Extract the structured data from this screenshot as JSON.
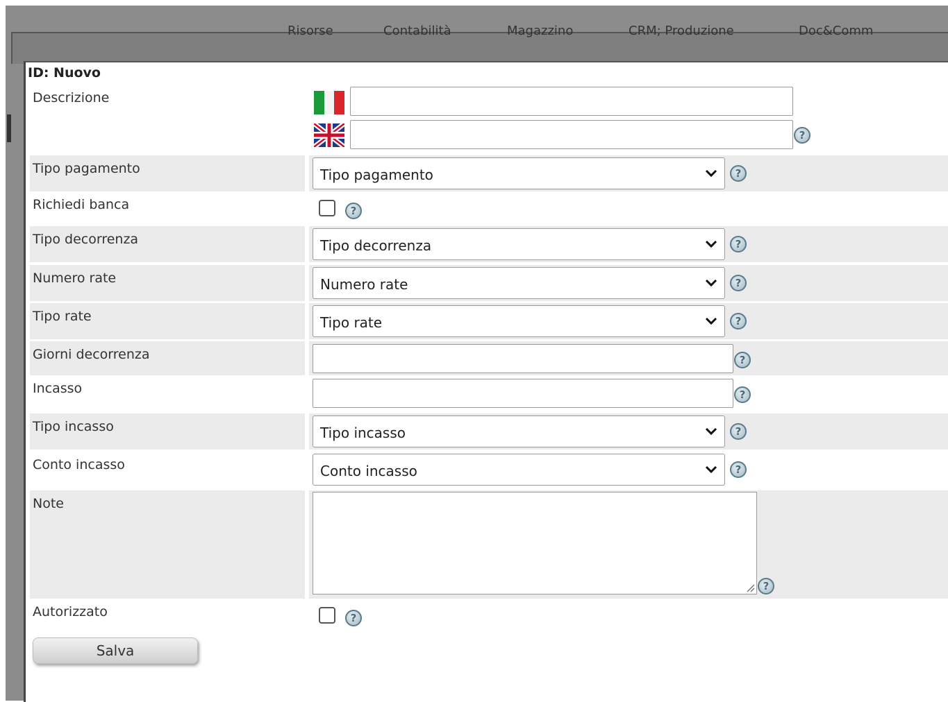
{
  "nav": [
    "Risorse",
    "Contabilità",
    "Magazzino",
    "CRM; Produzione",
    "Doc&Comm"
  ],
  "modal": {
    "id_label": "ID: Nuovo",
    "fields": {
      "descrizione": "Descrizione",
      "tipo_pagamento": "Tipo pagamento",
      "richiedi_banca": "Richiedi banca",
      "tipo_decorrenza": "Tipo decorrenza",
      "numero_rate": "Numero rate",
      "tipo_rate": "Tipo rate",
      "giorni_decorrenza": "Giorni decorrenza",
      "incasso": "Incasso",
      "tipo_incasso": "Tipo incasso",
      "conto_incasso": "Conto incasso",
      "note": "Note",
      "autorizzato": "Autorizzato"
    },
    "selects": {
      "tipo_pagamento": "Tipo pagamento",
      "tipo_decorrenza": "Tipo decorrenza",
      "numero_rate": "Numero rate",
      "tipo_rate": "Tipo rate",
      "tipo_incasso": "Tipo incasso",
      "conto_incasso": "Conto incasso"
    },
    "help_glyph": "?",
    "save_label": "Salva"
  },
  "icons": {
    "flag_it": "italian-flag-icon",
    "flag_en": "uk-flag-icon",
    "help": "help-icon",
    "chevron": "chevron-down-icon"
  },
  "colors": {
    "shaded_row": "#ebebeb",
    "overlay": "#8c8c8c",
    "help_border": "#5a7a8a"
  }
}
